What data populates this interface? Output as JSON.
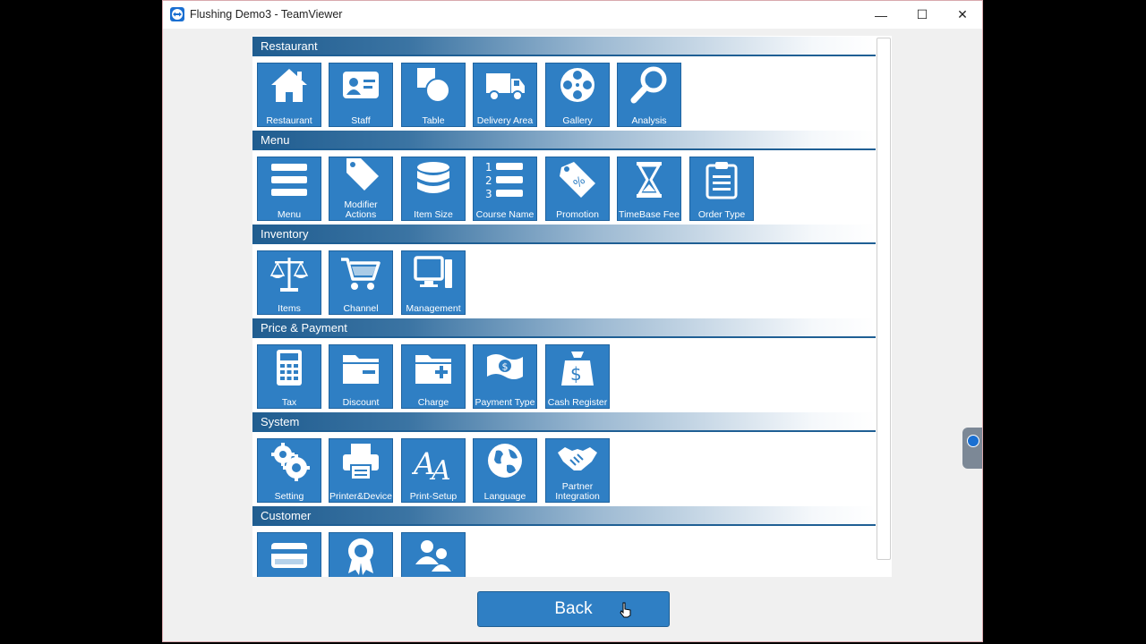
{
  "window": {
    "title": "Flushing Demo3 - TeamViewer",
    "controls": {
      "minimize": "—",
      "maximize": "☐",
      "close": "✕"
    }
  },
  "sections": [
    {
      "title": "Restaurant",
      "tiles": [
        {
          "label": "Restaurant",
          "icon": "home-icon"
        },
        {
          "label": "Staff",
          "icon": "id-card-icon"
        },
        {
          "label": "Table",
          "icon": "table-shapes-icon"
        },
        {
          "label": "Delivery Area",
          "icon": "truck-icon"
        },
        {
          "label": "Gallery",
          "icon": "film-reel-icon"
        },
        {
          "label": "Analysis",
          "icon": "magnifier-icon"
        }
      ]
    },
    {
      "title": "Menu",
      "tiles": [
        {
          "label": "Menu",
          "icon": "list-bars-icon"
        },
        {
          "label": "Modifier Actions",
          "icon": "tag-icon"
        },
        {
          "label": "Item Size",
          "icon": "database-icon"
        },
        {
          "label": "Course Name",
          "icon": "numbered-list-icon"
        },
        {
          "label": "Promotion",
          "icon": "percent-tag-icon"
        },
        {
          "label": "TimeBase Fee",
          "icon": "hourglass-icon"
        },
        {
          "label": "Order Type",
          "icon": "clipboard-icon"
        }
      ]
    },
    {
      "title": "Inventory",
      "tiles": [
        {
          "label": "Items",
          "icon": "scale-icon"
        },
        {
          "label": "Channel",
          "icon": "cart-icon"
        },
        {
          "label": "Management",
          "icon": "computer-icon"
        }
      ]
    },
    {
      "title": "Price & Payment",
      "tiles": [
        {
          "label": "Tax",
          "icon": "calculator-icon"
        },
        {
          "label": "Discount",
          "icon": "folder-minus-icon"
        },
        {
          "label": "Charge",
          "icon": "folder-plus-icon"
        },
        {
          "label": "Payment Type",
          "icon": "banknote-icon"
        },
        {
          "label": "Cash Register",
          "icon": "money-bag-icon"
        }
      ]
    },
    {
      "title": "System",
      "tiles": [
        {
          "label": "Setting",
          "icon": "gears-icon"
        },
        {
          "label": "Printer&Device",
          "icon": "printer-icon"
        },
        {
          "label": "Print-Setup",
          "icon": "font-icon"
        },
        {
          "label": "Language",
          "icon": "globe-icon"
        },
        {
          "label": "Partner Integration",
          "icon": "handshake-icon"
        }
      ]
    },
    {
      "title": "Customer",
      "tiles": [
        {
          "label": "",
          "icon": "credit-card-icon"
        },
        {
          "label": "",
          "icon": "award-icon"
        },
        {
          "label": "",
          "icon": "users-icon"
        }
      ]
    }
  ],
  "back_label": "Back",
  "colors": {
    "tile": "#2f7fc4",
    "header": "#205d90",
    "accent": "#1a6fd1"
  }
}
